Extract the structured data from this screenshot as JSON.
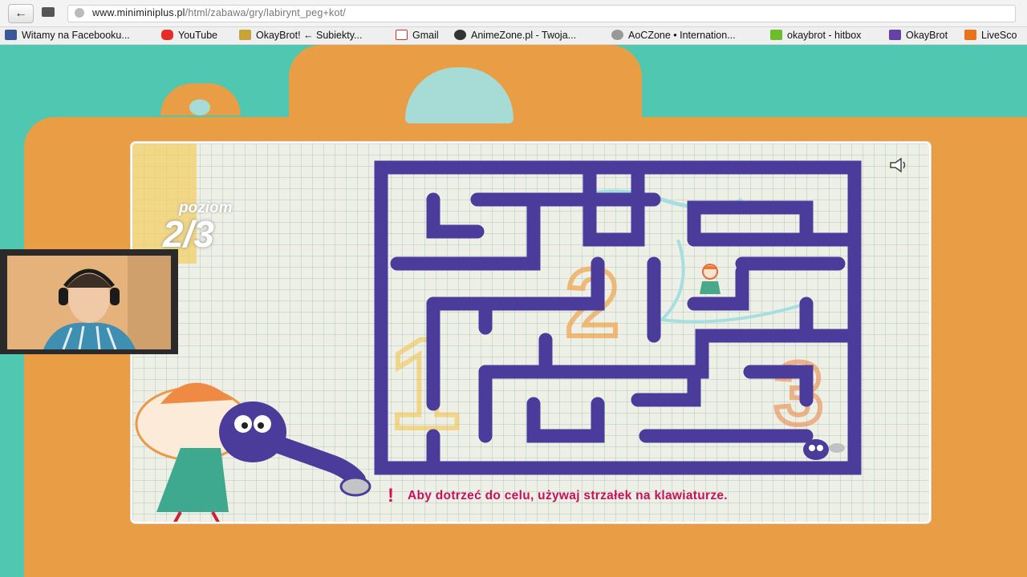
{
  "browser": {
    "url_domain": "www.miniminiplus.pl",
    "url_path": "/html/zabawa/gry/labirynt_peg+kot/",
    "bookmarks": [
      {
        "label": "Witamy na Facebooku...",
        "icon": "facebook-icon",
        "color": "#3b5998"
      },
      {
        "label": "YouTube",
        "icon": "youtube-icon",
        "color": "#e52d27"
      },
      {
        "label": "OkayBrot! ← Subiekty...",
        "icon": "okaybrot-icon",
        "color": "#c9a23a"
      },
      {
        "label": "Gmail",
        "icon": "gmail-icon",
        "color": "#d93025"
      },
      {
        "label": "AnimeZone.pl - Twoja...",
        "icon": "animezone-icon",
        "color": "#333333"
      },
      {
        "label": "AoCZone • Internation...",
        "icon": "aoczone-icon",
        "color": "#777777"
      },
      {
        "label": "okaybrot - hitbox",
        "icon": "hitbox-icon",
        "color": "#6cbd2b"
      },
      {
        "label": "OkayBrot",
        "icon": "twitch-icon",
        "color": "#6441a5"
      },
      {
        "label": "LiveSco",
        "icon": "livescore-icon",
        "color": "#e8731a"
      }
    ]
  },
  "game": {
    "level_label": "poziom",
    "level_value": "2/3",
    "instruction": "Aby dotrzeć do celu, używaj strzałek na klawiaturze.",
    "colors": {
      "maze_wall": "#4b3b9a",
      "bag": "#e99d45",
      "background": "#4fc7b1",
      "instruction": "#c8115a"
    }
  }
}
